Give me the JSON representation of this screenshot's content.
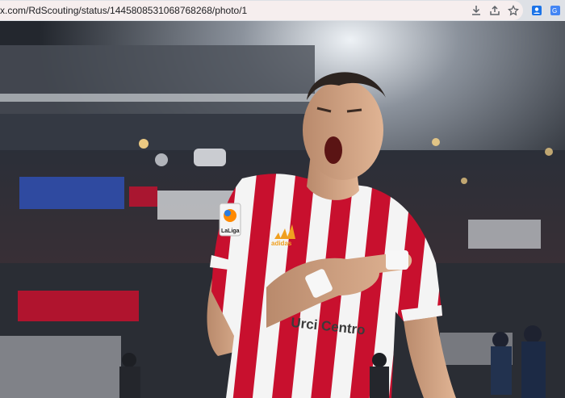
{
  "browser": {
    "url": "x.com/RdScouting/status/1445808531068768268/photo/1",
    "icons": [
      "download-icon",
      "share-icon",
      "star-bookmark-icon",
      "profile-extension-icon",
      "translate-extension-icon"
    ]
  },
  "photo": {
    "jersey_brand": "adidas",
    "jersey_sponsor": "Urci Centro",
    "league_badge": "LaLiga",
    "colors": {
      "jersey_red": "#c8102e",
      "jersey_white": "#f4f4f4",
      "stadium_dark": "#1d2128"
    }
  }
}
